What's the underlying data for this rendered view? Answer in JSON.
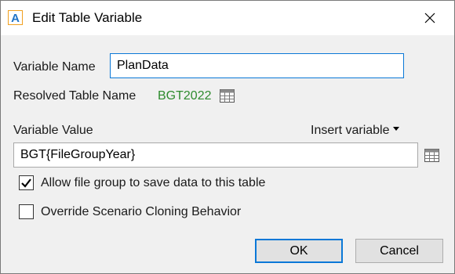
{
  "dialog": {
    "title": "Edit Table Variable",
    "app_icon_letter": "A"
  },
  "variable_name": {
    "label": "Variable Name",
    "value": "PlanData"
  },
  "resolved_table": {
    "label": "Resolved Table Name",
    "value": "BGT2022"
  },
  "variable_value": {
    "label": "Variable Value",
    "insert_label": "Insert variable",
    "value": "BGT{FileGroupYear}"
  },
  "options": {
    "allow_save_label": "Allow file group to save data to this table",
    "allow_save_checked": true,
    "override_label": "Override Scenario Cloning Behavior",
    "override_checked": false
  },
  "buttons": {
    "ok": "OK",
    "cancel": "Cancel"
  },
  "colors": {
    "accent": "#0a78d7",
    "resolved_value": "#2e8b2e",
    "background": "#f0f0f0"
  }
}
